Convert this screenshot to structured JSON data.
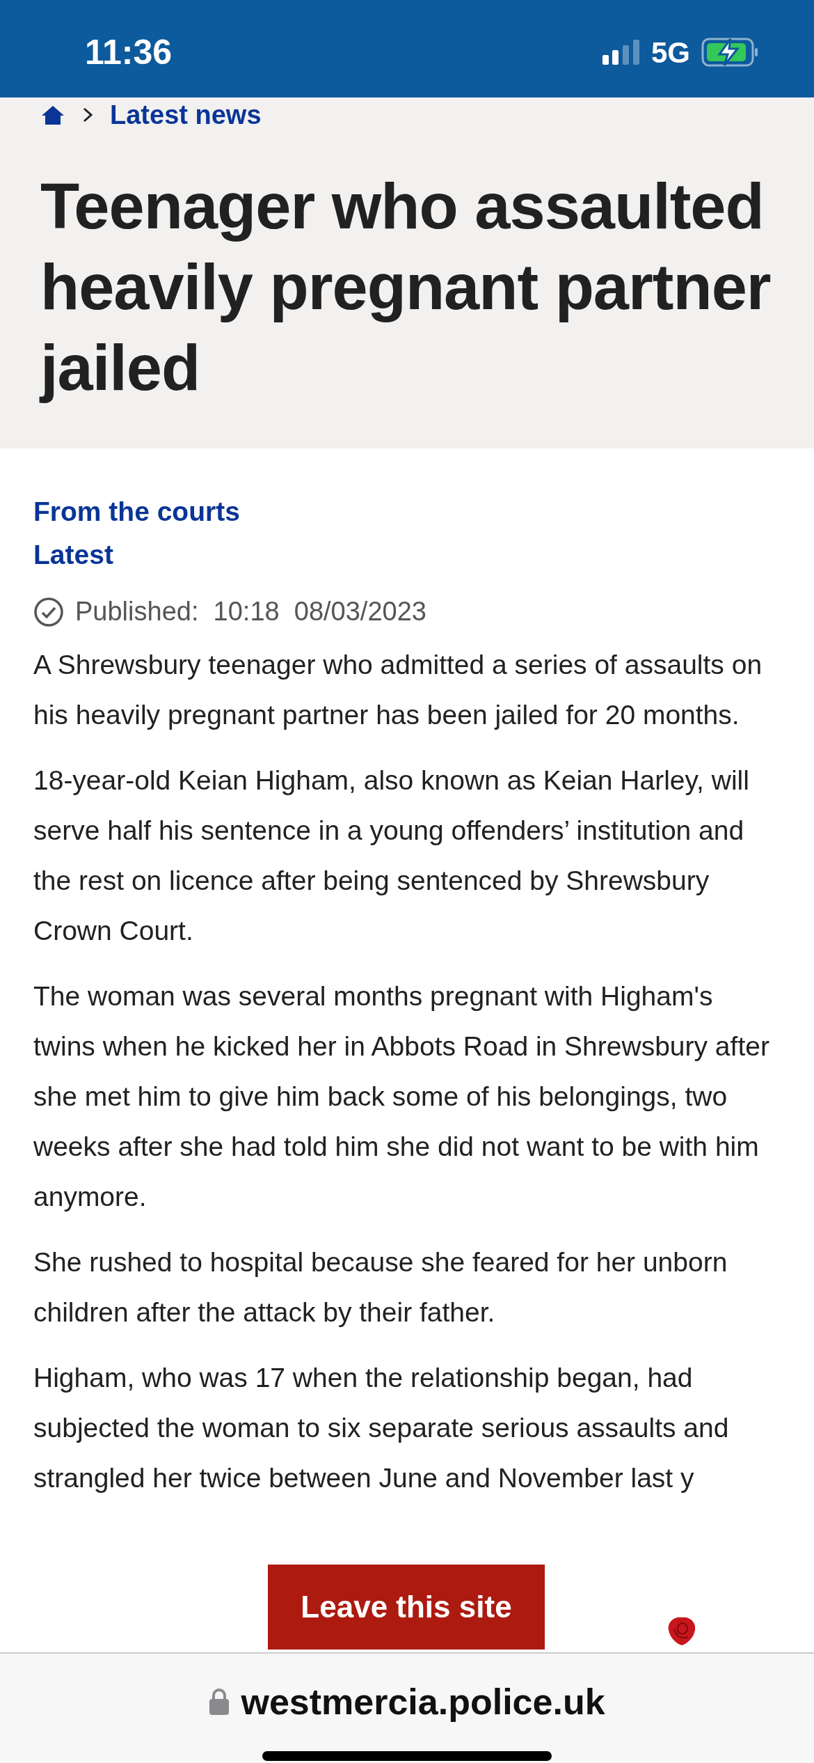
{
  "status_bar": {
    "time": "11:36",
    "network": "5G"
  },
  "breadcrumb": {
    "items": [
      "Latest news"
    ]
  },
  "header": {
    "title": "Teenager who assaulted heavily pregnant partner jailed"
  },
  "categories": [
    "From the courts",
    "Latest"
  ],
  "published": {
    "label": "Published:",
    "time": "10:18",
    "date": "08/03/2023"
  },
  "paragraphs": [
    "A Shrewsbury teenager who admitted a series of assaults on his heavily pregnant partner has been jailed for 20 months.",
    "18-year-old Keian Higham, also known as Keian Harley, will serve half his sentence in a young offenders’ institution and the rest on licence after being sentenced by Shrewsbury Crown Court.",
    "The woman was several months pregnant with Higham's twins when he kicked her in Abbots Road in Shrewsbury after she met him to give him back some of his belongings, two weeks after she had told him she did not want to be with him anymore.",
    "She rushed to hospital because she feared for her unborn children after the attack by their father.",
    "Higham, who was 17 when the relationship began, had subjected the woman to six separate serious assaults and strangled her twice between June and November last y"
  ],
  "leave_button": {
    "label": "Leave this site"
  },
  "browser_bar": {
    "url": "westmercia.police.uk"
  }
}
